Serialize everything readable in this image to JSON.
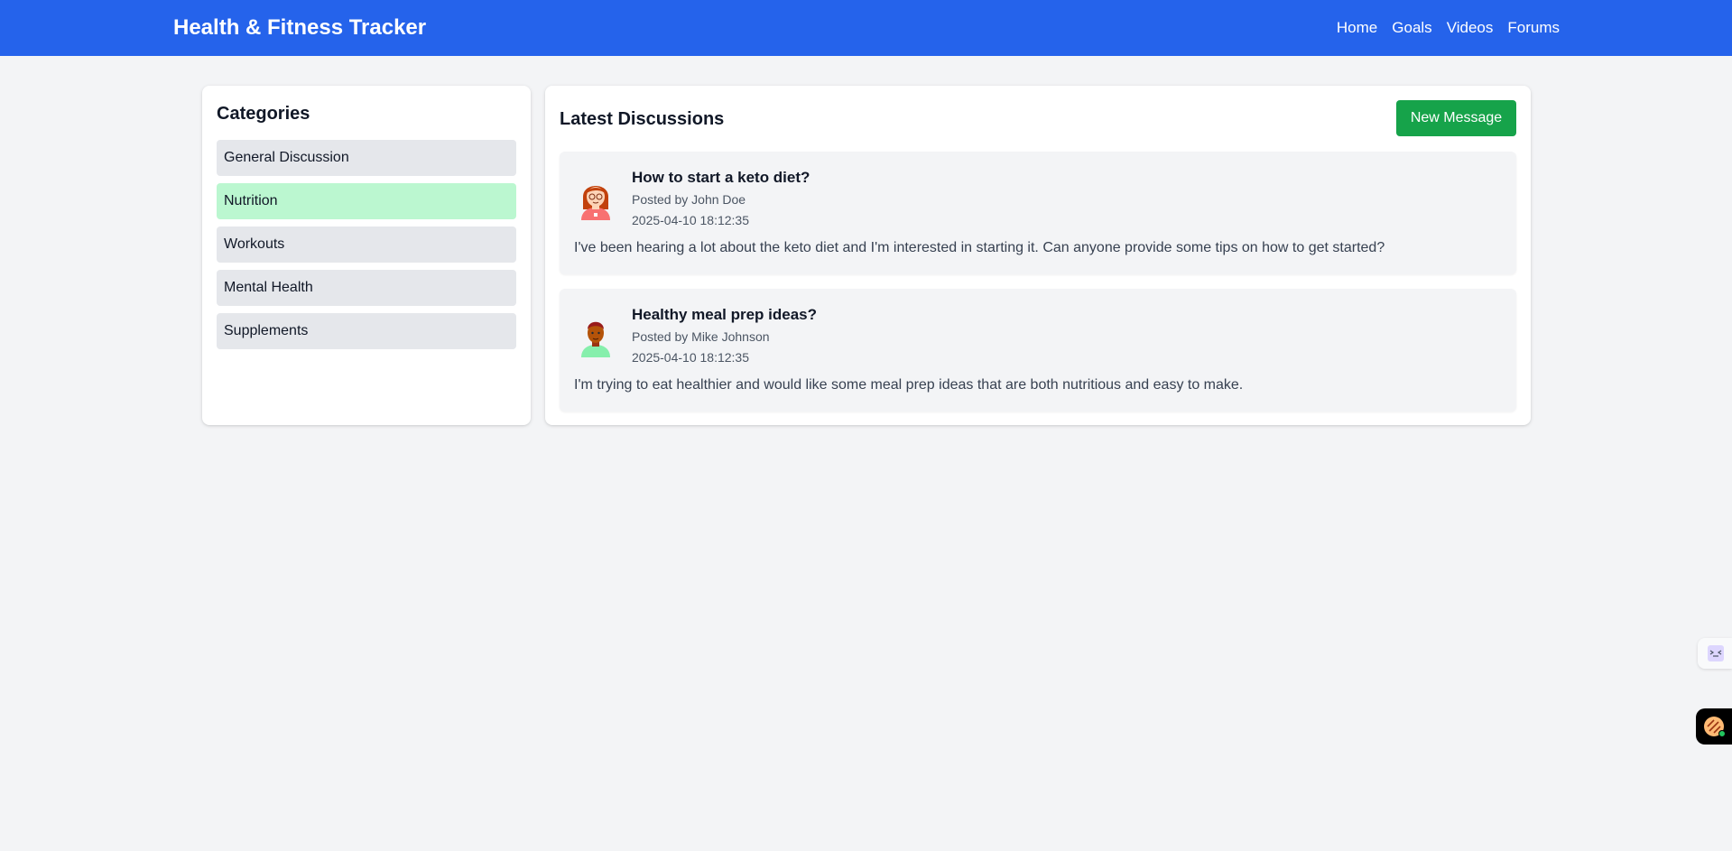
{
  "header": {
    "title": "Health & Fitness Tracker",
    "nav": [
      "Home",
      "Goals",
      "Videos",
      "Forums"
    ]
  },
  "categories": {
    "title": "Categories",
    "items": [
      "General Discussion",
      "Nutrition",
      "Workouts",
      "Mental Health",
      "Supplements"
    ],
    "active": "Nutrition"
  },
  "discussions": {
    "title": "Latest Discussions",
    "new_button": "New Message",
    "posts": [
      {
        "title": "How to start a keto diet?",
        "author": "Posted by John Doe",
        "date": "2025-04-10 18:12:35",
        "body": "I've been hearing a lot about the keto diet and I'm interested in starting it. Can anyone provide some tips on how to get started?",
        "avatar": "female-avatar-icon"
      },
      {
        "title": "Healthy meal prep ideas?",
        "author": "Posted by Mike Johnson",
        "date": "2025-04-10 18:12:35",
        "body": "I'm trying to eat healthier and would like some meal prep ideas that are both nutritious and easy to make.",
        "avatar": "male-avatar-icon"
      }
    ]
  },
  "colors": {
    "header": "#2563eb",
    "active_category": "#bbf7d0",
    "button": "#16a34a"
  }
}
